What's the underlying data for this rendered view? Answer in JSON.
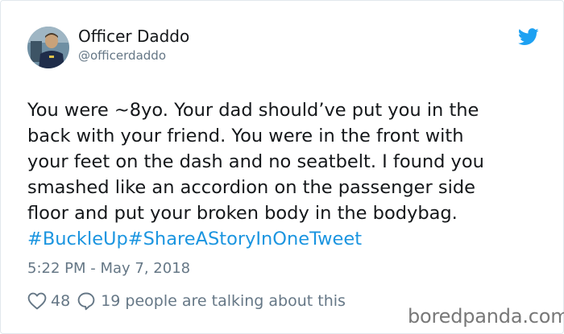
{
  "author": {
    "display_name": "Officer Daddo",
    "handle": "@officerdaddo"
  },
  "tweet": {
    "lines": [
      "You were ~8yo. Your dad should’ve put you in the",
      "back with your friend. You were in the front with",
      "your feet on the dash and no seatbelt. I found you",
      "smashed like an accordion on the passenger side",
      "floor and put your broken body in the bodybag."
    ],
    "hashtags": [
      "#BuckleUp",
      "#ShareAStoryInOneTweet"
    ],
    "timestamp": "5:22 PM - May 7, 2018"
  },
  "engagement": {
    "likes": "48",
    "replies_text": "19 people are talking about this"
  },
  "watermark": "boredpanda.com",
  "icons": {
    "like": "heart-icon",
    "reply": "speech-bubble-icon",
    "brand": "twitter-bird-icon"
  },
  "colors": {
    "text": "#14171a",
    "muted": "#657786",
    "link": "#1b95e0",
    "twitter_blue": "#1da1f2"
  }
}
